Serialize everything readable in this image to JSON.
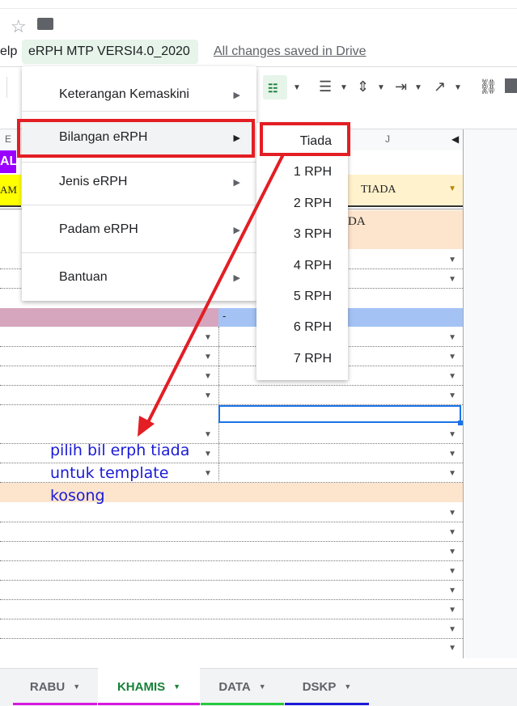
{
  "menubar": {
    "help_fragment": "elp",
    "doc_menu_label": "eRPH MTP VERSI4.0_2020",
    "saved_status": "All changes saved in Drive"
  },
  "column_headers": {
    "e": "E",
    "j": "J"
  },
  "cells": {
    "header_frag_left": "AL",
    "yellow_frag_left": "AM",
    "tiada_dropdown": "TIADA",
    "peach_frag": "DA",
    "dash": "-"
  },
  "menu": {
    "items": [
      {
        "label": "Keterangan Kemaskini"
      },
      {
        "label": "Bilangan eRPH"
      },
      {
        "label": "Jenis eRPH"
      },
      {
        "label": "Padam eRPH"
      },
      {
        "label": "Bantuan"
      }
    ]
  },
  "submenu": {
    "items": [
      "Tiada",
      "1 RPH",
      "2 RPH",
      "3 RPH",
      "4 RPH",
      "5 RPH",
      "6 RPH",
      "7 RPH"
    ]
  },
  "annotation": {
    "line1": "pilih bil erph tiada",
    "line2": "untuk template",
    "line3": "kosong"
  },
  "sheet_tabs": [
    {
      "label": "RABU",
      "color": "#d61adf"
    },
    {
      "label": "KHAMIS",
      "color": "#d61adf",
      "active": true
    },
    {
      "label": "DATA",
      "color": "#27c93f"
    },
    {
      "label": "DSKP",
      "color": "#1a1ad6"
    }
  ],
  "colors": {
    "highlight_red": "#e31e24",
    "annotation_blue": "#1a1ad6",
    "peach": "#fce4cd",
    "mauve": "#d5a6bd",
    "blue_row": "#a4c2f4",
    "yellow": "#fff2cc",
    "purple": "#9900ff"
  }
}
